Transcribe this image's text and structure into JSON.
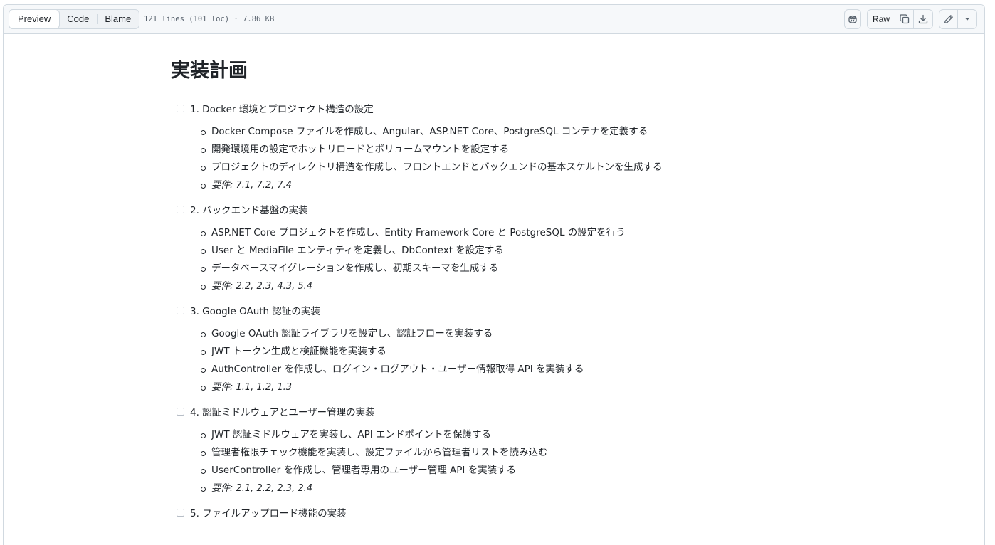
{
  "toolbar": {
    "tabs": [
      "Preview",
      "Code",
      "Blame"
    ],
    "active_tab": "Preview",
    "file_meta": "121 lines (101 loc) · 7.86 KB",
    "raw_label": "Raw"
  },
  "doc": {
    "title": "実装計画",
    "tasks": [
      {
        "label": "1. Docker 環境とプロジェクト構造の設定",
        "items": [
          "Docker Compose ファイルを作成し、Angular、ASP.NET Core、PostgreSQL コンテナを定義する",
          "開発環境用の設定でホットリロードとボリュームマウントを設定する",
          "プロジェクトのディレクトリ構造を作成し、フロントエンドとバックエンドの基本スケルトンを生成する"
        ],
        "requirements": "要件: 7.1, 7.2, 7.4"
      },
      {
        "label": "2. バックエンド基盤の実装",
        "items": [
          "ASP.NET Core プロジェクトを作成し、Entity Framework Core と PostgreSQL の設定を行う",
          "User と MediaFile エンティティを定義し、DbContext を設定する",
          "データベースマイグレーションを作成し、初期スキーマを生成する"
        ],
        "requirements": "要件: 2.2, 2.3, 4.3, 5.4"
      },
      {
        "label": "3. Google OAuth 認証の実装",
        "items": [
          "Google OAuth 認証ライブラリを設定し、認証フローを実装する",
          "JWT トークン生成と検証機能を実装する",
          "AuthController を作成し、ログイン・ログアウト・ユーザー情報取得 API を実装する"
        ],
        "requirements": "要件: 1.1, 1.2, 1.3"
      },
      {
        "label": "4. 認証ミドルウェアとユーザー管理の実装",
        "items": [
          "JWT 認証ミドルウェアを実装し、API エンドポイントを保護する",
          "管理者権限チェック機能を実装し、設定ファイルから管理者リストを読み込む",
          "UserController を作成し、管理者専用のユーザー管理 API を実装する"
        ],
        "requirements": "要件: 2.1, 2.2, 2.3, 2.4"
      },
      {
        "label": "5. ファイルアップロード機能の実装",
        "items": [],
        "requirements": ""
      }
    ]
  },
  "icons": {
    "copilot": "copilot-icon",
    "copy": "copy-icon",
    "download": "download-icon",
    "edit": "pencil-icon",
    "more": "triangle-down-icon"
  }
}
